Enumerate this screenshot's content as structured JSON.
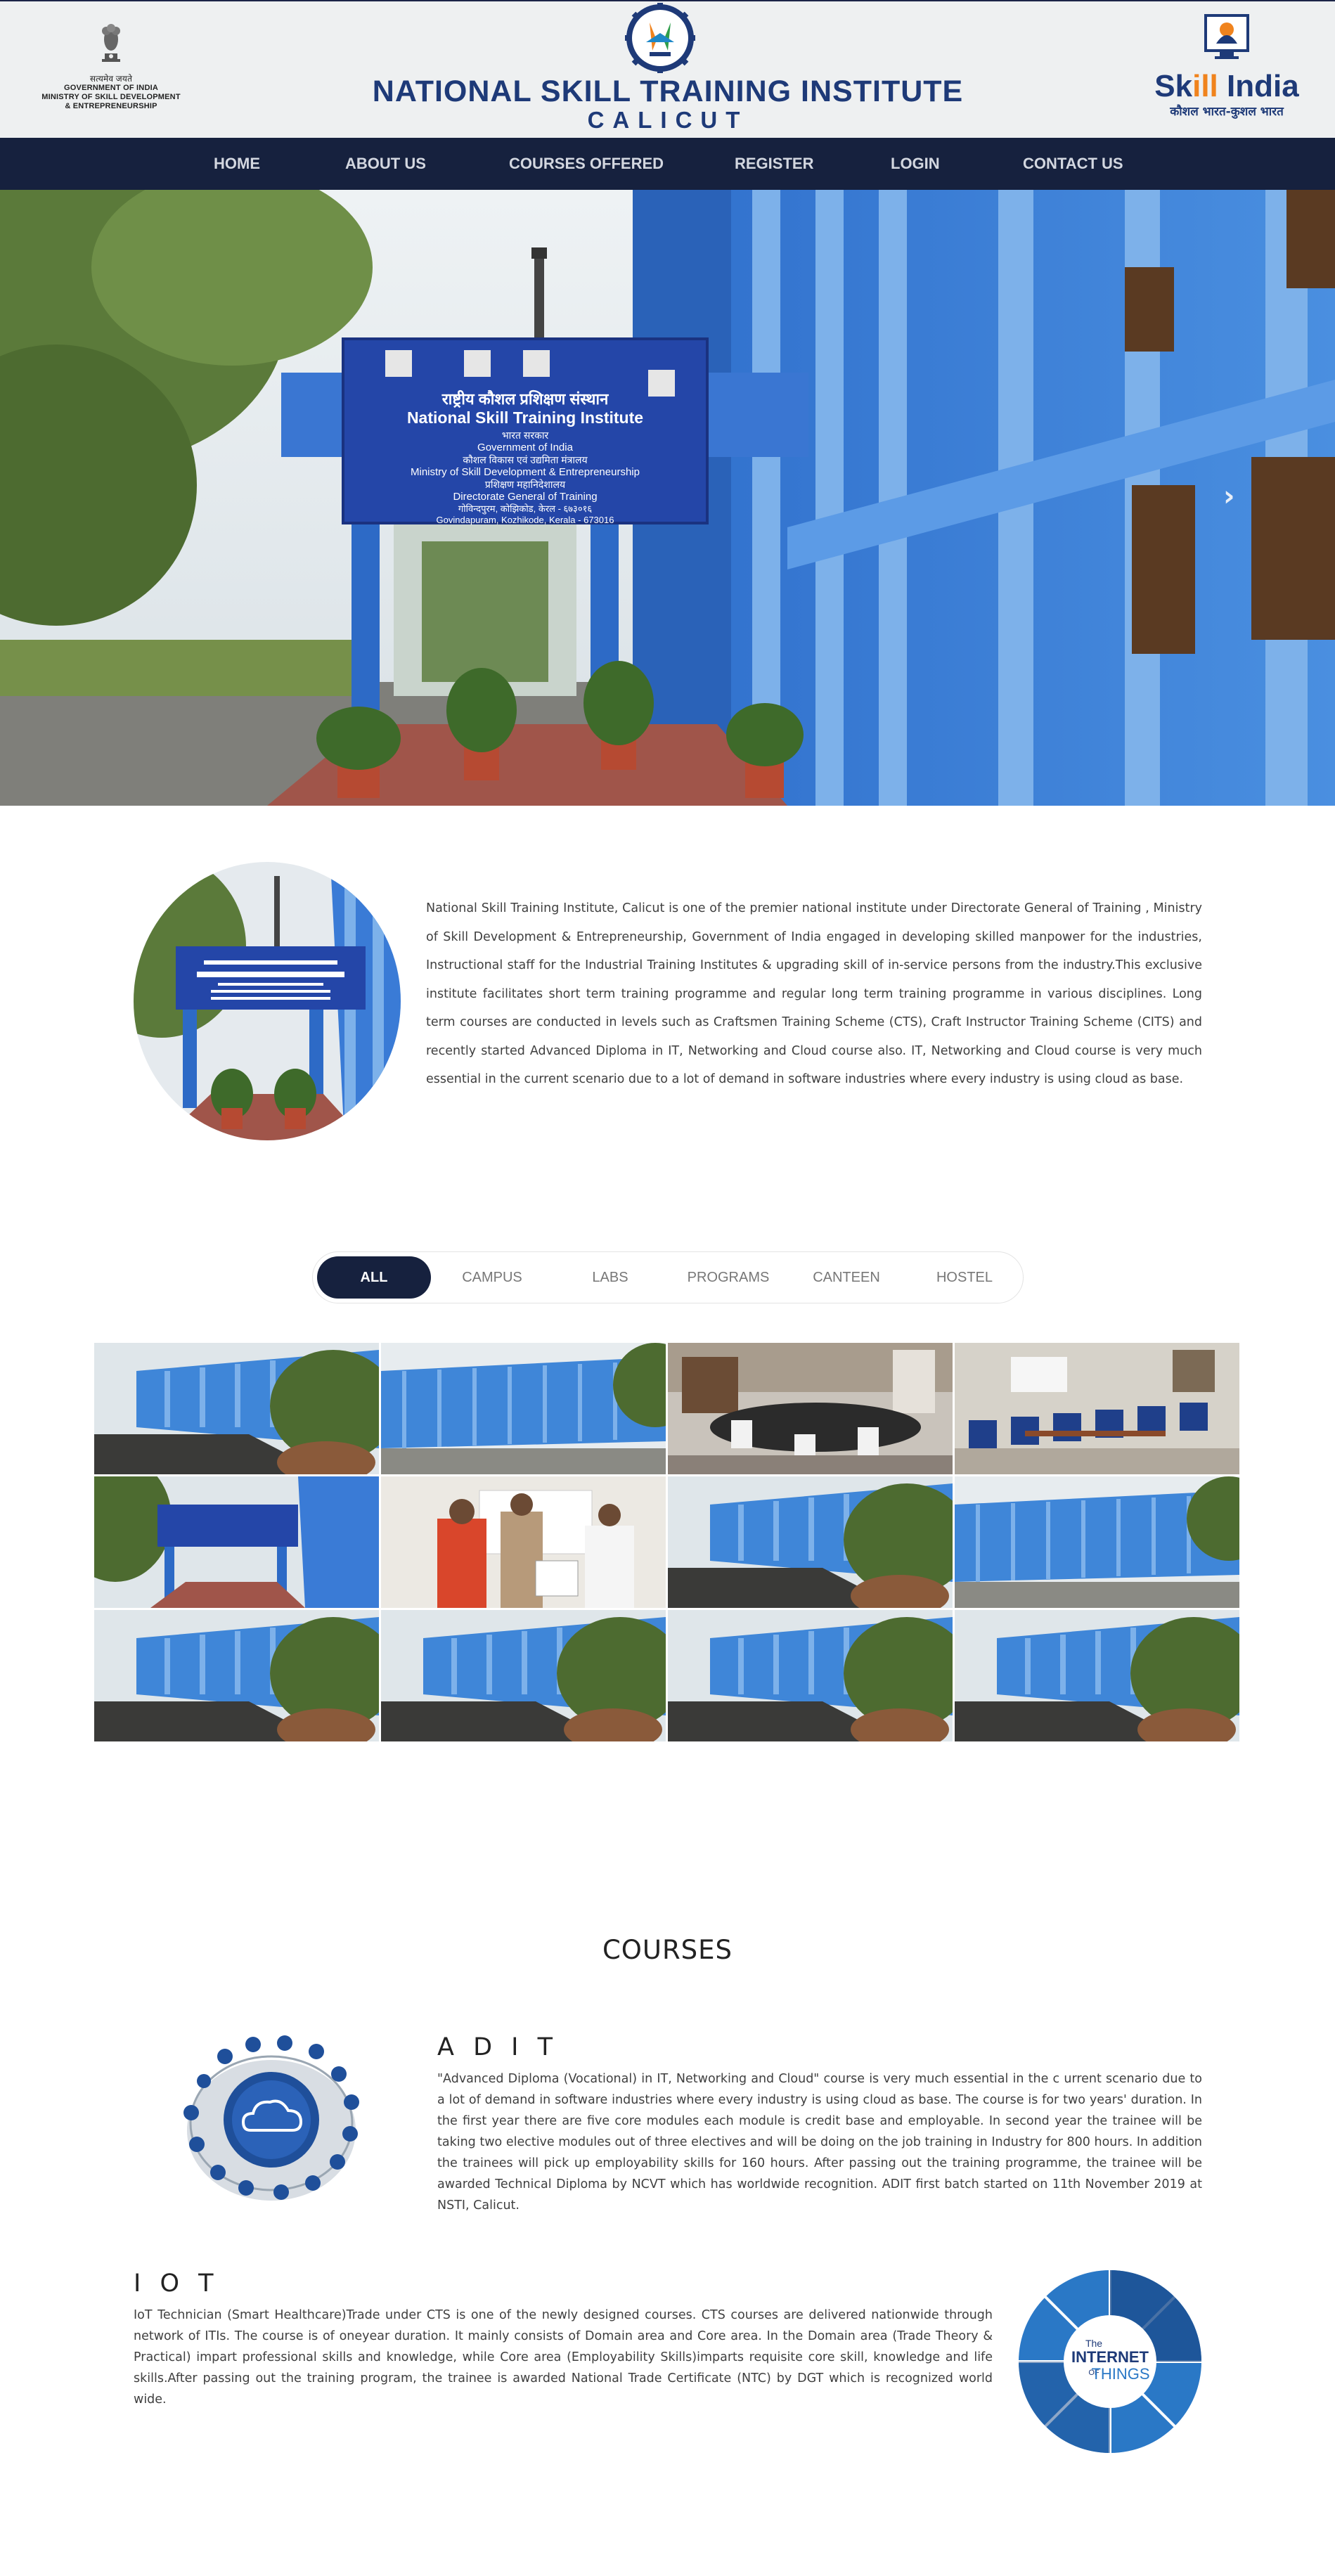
{
  "header": {
    "gov": {
      "line_hindi": "सत्यमेव जयते",
      "line1": "GOVERNMENT OF INDIA",
      "line2": "MINISTRY OF SKILL DEVELOPMENT",
      "line3": "& ENTREPRENEURSHIP"
    },
    "institute_name": "NATIONAL SKILL TRAINING INSTITUTE",
    "institute_city": "CALICUT",
    "skill_india": {
      "title_pre": "Sk",
      "title_ill": "ill",
      "title_post": " India",
      "tagline": "कौशल भारत-कुशल भारत"
    }
  },
  "nav": {
    "items": [
      {
        "label": "HOME"
      },
      {
        "label": "ABOUT US"
      },
      {
        "label": "COURSES OFFERED"
      },
      {
        "label": "REGISTER"
      },
      {
        "label": "LOGIN"
      },
      {
        "label": "CONTACT US"
      }
    ]
  },
  "hero": {
    "sign": {
      "hindi_title": "राष्ट्रीय कौशल प्रशिक्षण संस्थान",
      "title": "National Skill Training Institute",
      "hindi_gov": "भारत सरकार",
      "gov": "Government of India",
      "hindi_ministry": "कौशल विकास एवं उद्यमिता मंत्रालय",
      "ministry1": "Ministry of Skill Development & Entrepreneurship",
      "hindi_dgt": "प्रशिक्षण महानिदेशालय",
      "dgt": "Directorate General of Training",
      "hindi_address": "गोविन्दपुरम, कोझिकोड, केरल - ६७३०१६",
      "address": "Govindapuram, Kozhikode, Kerala - 673016"
    },
    "next_label": "›"
  },
  "about": {
    "text": "National Skill Training Institute, Calicut is one of the premier national institute under Directorate General of Training , Ministry of Skill Development & Entrepreneurship, Government of India engaged in developing skilled manpower for the industries, Instructional staff for the Industrial Training Institutes & upgrading skill of in-service persons from the industry.This exclusive institute facilitates short term training programme and regular long term training programme in various disciplines. Long term courses are conducted in levels such as Craftsmen Training Scheme (CTS), Craft Instructor Training Scheme (CITS) and recently started Advanced Diploma in IT, Networking and Cloud course also. IT, Networking and Cloud course is very much essential in the current scenario due to a lot of demand in software industries where every industry is using cloud as base."
  },
  "gallery_filter": {
    "buttons": [
      {
        "label": "ALL",
        "active": true
      },
      {
        "label": "CAMPUS",
        "active": false
      },
      {
        "label": "LABS",
        "active": false
      },
      {
        "label": "PROGRAMS",
        "active": false
      },
      {
        "label": "CANTEEN",
        "active": false
      },
      {
        "label": "HOSTEL",
        "active": false
      }
    ]
  },
  "gallery": {
    "images": [
      {
        "kind": "campus-building"
      },
      {
        "kind": "campus-wide"
      },
      {
        "kind": "conference-room"
      },
      {
        "kind": "classroom"
      },
      {
        "kind": "entrance"
      },
      {
        "kind": "program-event"
      },
      {
        "kind": "campus-building"
      },
      {
        "kind": "campus-wide"
      },
      {
        "kind": "campus-building"
      },
      {
        "kind": "campus-building"
      },
      {
        "kind": "campus-building"
      },
      {
        "kind": "campus-building"
      }
    ]
  },
  "courses": {
    "heading": "COURSES",
    "adit": {
      "title": "A D I T",
      "text": "\"Advanced Diploma (Vocational) in IT, Networking and Cloud\" course is very much essential in the c urrent scenario due to a lot of demand in software industries where every industry is using cloud as base. The course is for two years' duration. In the first year there are five core modules each module is credit base and employable. In second year the trainee will be taking two elective modules out of three electives and will be doing on the job training in Industry for 800 hours. In addition the trainees will pick up employability skills for 160 hours. After passing out the training programme, the trainee will be awarded Technical Diploma by NCVT which has worldwide recognition. ADIT first batch started on 11th November 2019 at NSTI, Calicut."
    },
    "iot": {
      "title": "I O T",
      "text": "IoT Technician (Smart Healthcare)Trade under CTS is one of the newly designed courses. CTS courses are delivered nationwide through network of ITIs. The course is of oneyear duration. It mainly consists of Domain area and Core area. In the Domain area (Trade Theory & Practical) impart professional skills and knowledge, while Core area (Employability Skills)imparts requisite core skill, knowledge and life skills.After passing out the training program, the trainee is awarded National Trade Certificate (NTC) by DGT which is recognized world wide.",
      "illus_the": "The",
      "illus_internet": "INTERNET",
      "illus_of": "OF",
      "illus_things": "THINGS"
    }
  },
  "colors": {
    "nav_bg": "#16213e",
    "header_bg": "#eef0f1",
    "brand_blue": "#1e3a78",
    "building_blue": "#3f86d8"
  }
}
